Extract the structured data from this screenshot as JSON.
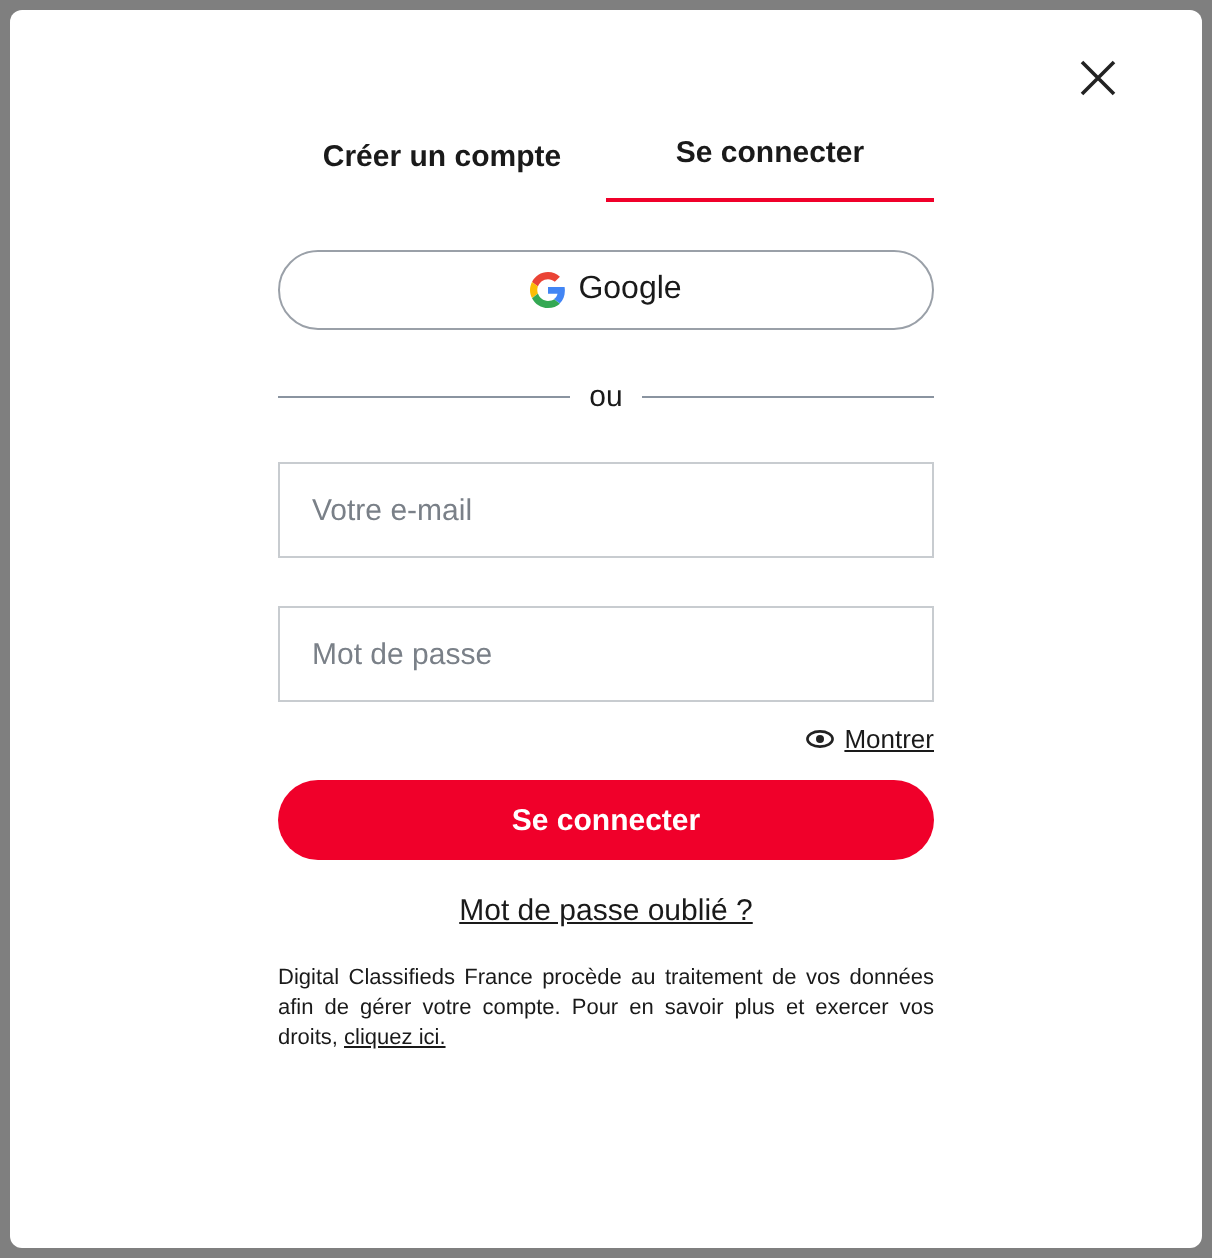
{
  "tabs": [
    {
      "label": "Créer un compte",
      "selected": false
    },
    {
      "label": "Se connecter",
      "selected": true
    }
  ],
  "google_button": {
    "label": "Google"
  },
  "divider": {
    "label": "ou"
  },
  "fields": [
    {
      "placeholder": "Votre e-mail"
    },
    {
      "placeholder": "Mot de passe"
    }
  ],
  "show_password": {
    "label": "Montrer"
  },
  "submit_button": {
    "label": "Se connecter"
  },
  "forgot_link": {
    "label": "Mot de passe oublié ?"
  },
  "notice": {
    "text": "Digital Classifieds France procède au traitement de vos données afin de gérer votre compte. Pour en savoir plus et exercer vos droits, ",
    "link": "cliquez ici."
  }
}
